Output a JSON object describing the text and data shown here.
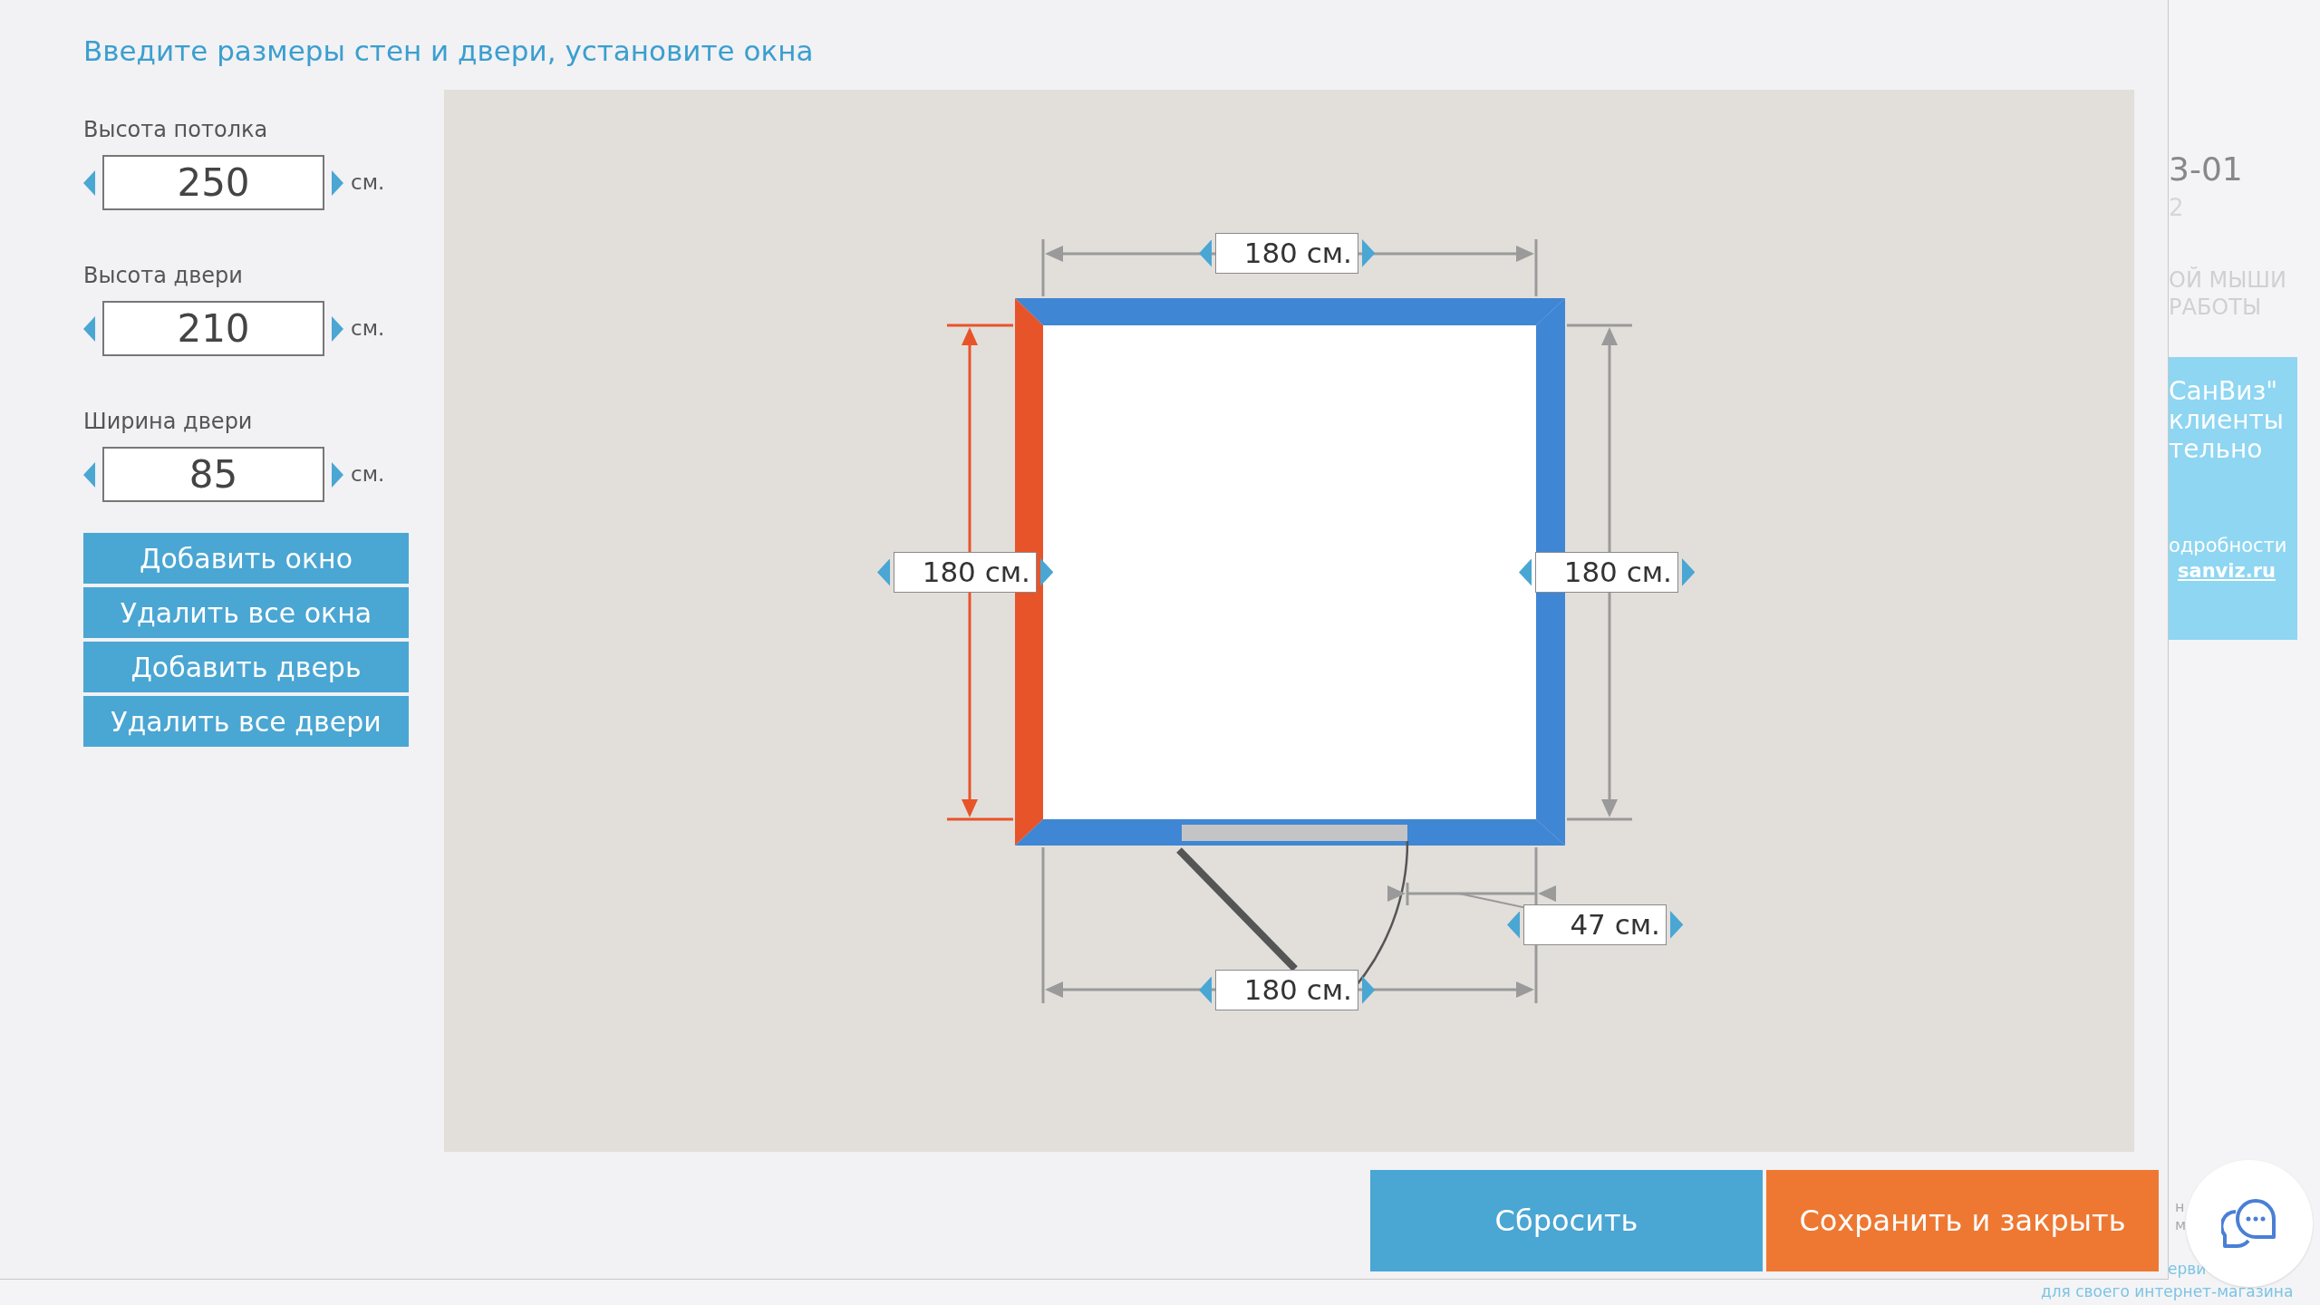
{
  "title": "Введите размеры стен и двери, установите окна",
  "fields": [
    {
      "label": "Высота потолка",
      "value": "250",
      "unit": "см."
    },
    {
      "label": "Высота двери",
      "value": "210",
      "unit": "см."
    },
    {
      "label": "Ширина двери",
      "value": "85",
      "unit": "см."
    }
  ],
  "buttons": [
    "Добавить окно",
    "Удалить все окна",
    "Добавить дверь",
    "Удалить все двери"
  ],
  "walls": [
    {
      "selected": false,
      "length": "180 см."
    },
    {
      "selected": true,
      "length": "180 см."
    },
    {
      "selected": false,
      "length": "180 см."
    },
    {
      "selected": false,
      "length": "180 см."
    }
  ],
  "door_offset": "47 см.",
  "actions": [
    {
      "label": "Сбросить",
      "kind": "secondary"
    },
    {
      "label": "Сохранить и закрыть",
      "kind": "primary"
    }
  ],
  "background": {
    "code": "3-01",
    "digit": "2",
    "hint_lines": [
      "ОЙ МЫШИ",
      "РАБОТЫ"
    ],
    "banner_lines": [
      "СанВиз\"",
      "клиенты",
      "тельно"
    ],
    "banner_more": "одробности",
    "banner_link": "sanviz.ru",
    "footer_lines": [
      "н",
      "м"
    ],
    "footer_link": "ерви",
    "footer_caption": "для своего интернет-магазина"
  }
}
